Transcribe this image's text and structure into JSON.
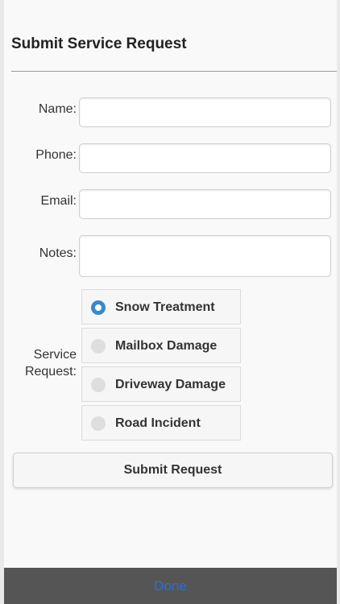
{
  "form": {
    "title": "Submit Service Request",
    "fields": [
      {
        "label": "Name:",
        "value": "",
        "placeholder": ""
      },
      {
        "label": "Phone:",
        "value": "",
        "placeholder": ""
      },
      {
        "label": "Email:",
        "value": "",
        "placeholder": ""
      },
      {
        "label": "Notes:",
        "value": "",
        "placeholder": ""
      }
    ],
    "service": {
      "label_line1": "Service",
      "label_line2": "Request:",
      "options": [
        {
          "label": "Snow Treatment",
          "selected": true
        },
        {
          "label": "Mailbox Damage",
          "selected": false
        },
        {
          "label": "Driveway Damage",
          "selected": false
        },
        {
          "label": "Road Incident",
          "selected": false
        }
      ]
    },
    "submit_label": "Submit Request"
  },
  "toolbar": {
    "done_label": "Done"
  },
  "colors": {
    "radio_selected": "#3a88c8",
    "done_text": "#2a6fd6",
    "toolbar_bg": "#555555"
  }
}
